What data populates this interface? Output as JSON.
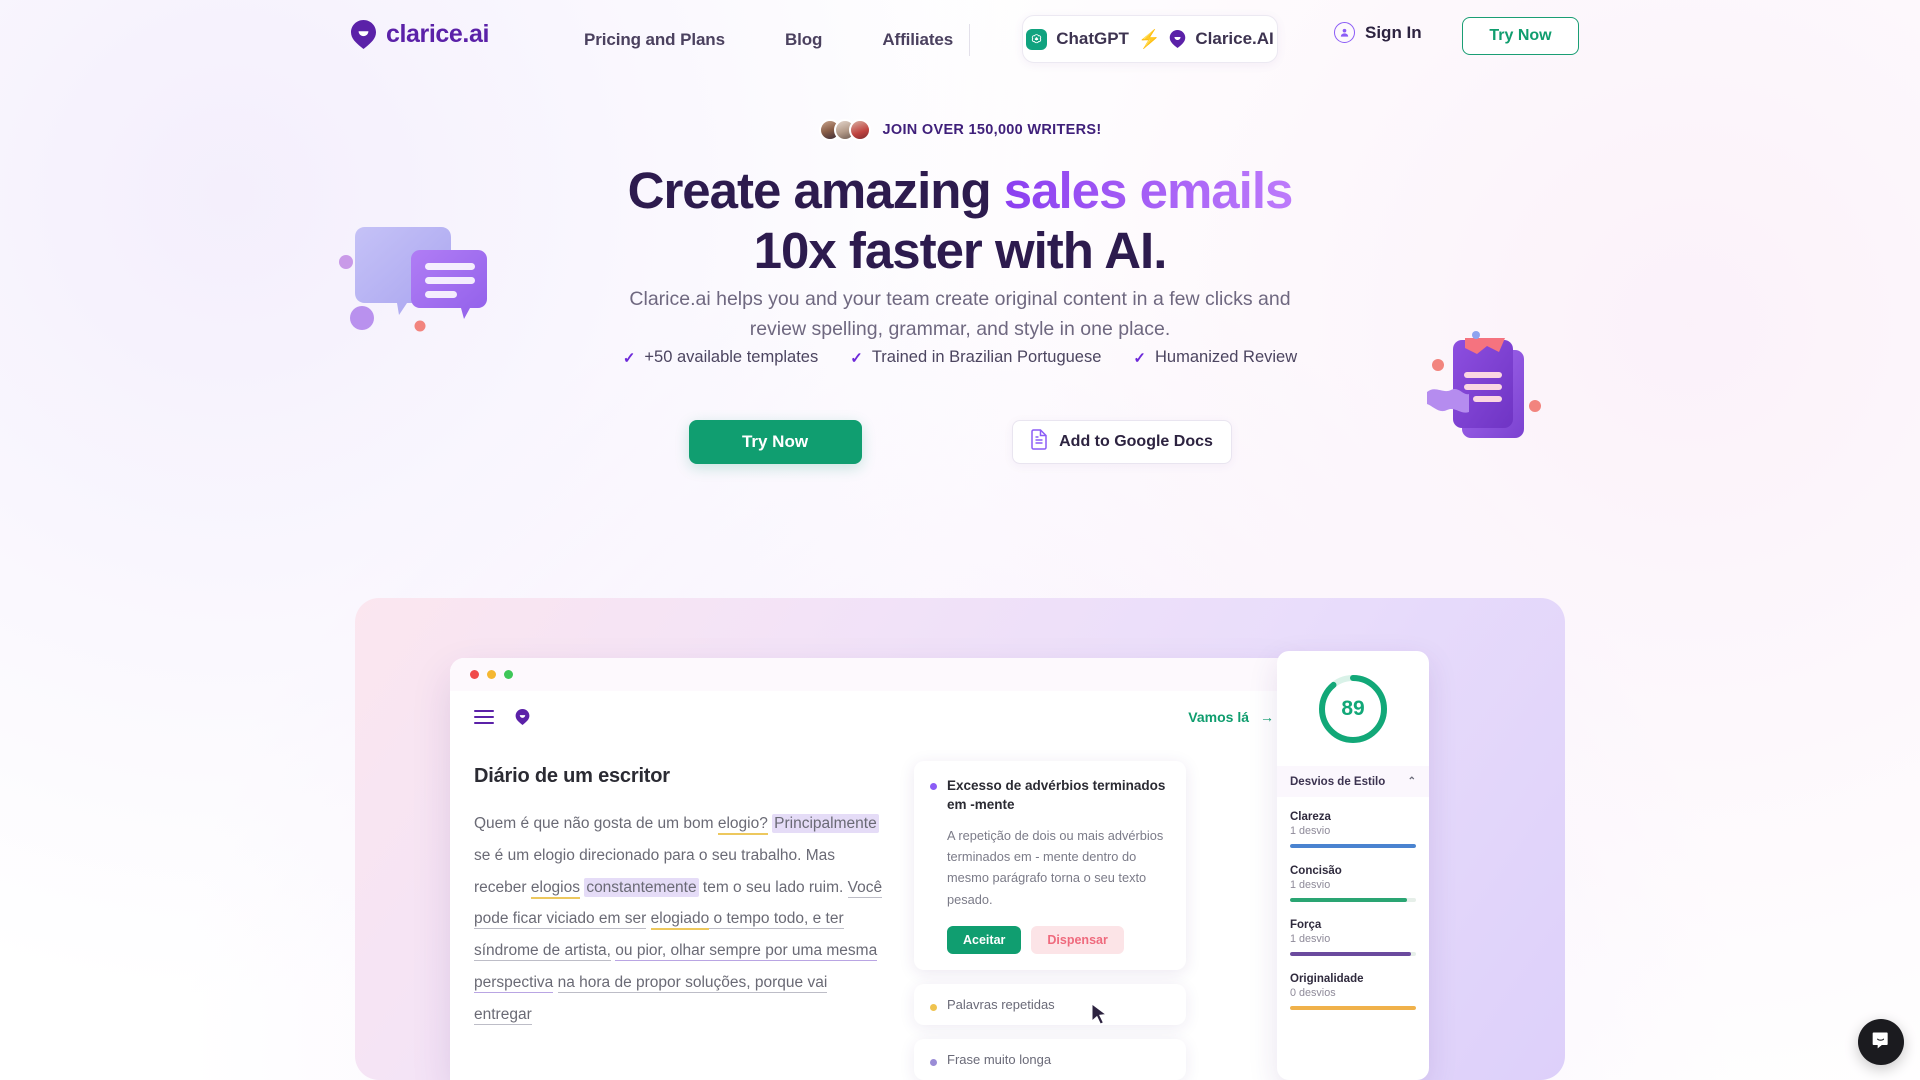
{
  "nav": {
    "logo_text": "clarice.ai",
    "links": [
      {
        "label": "Pricing and Plans"
      },
      {
        "label": "Blog"
      },
      {
        "label": "Affiliates"
      }
    ],
    "integration_pill": {
      "chatgpt_label": "ChatGPT",
      "clarice_label": "Clarice.AI",
      "bolt_glyph": "⚡"
    },
    "sign_in_label": "Sign In",
    "try_now_label": "Try Now"
  },
  "hero": {
    "join_text": "JOIN OVER 150,000 WRITERS!",
    "headline_line1_plain": "Create amazing ",
    "headline_line1_accent": "sales emails",
    "headline_line2": "10x faster with AI.",
    "subhead_line1": "Clarice.ai helps you and your team create original content in a few clicks and",
    "subhead_line2": "review spelling, grammar, and style in one place.",
    "features": [
      {
        "label": "+50 available templates"
      },
      {
        "label": "Trained in Brazilian Portuguese"
      },
      {
        "label": "Humanized Review"
      }
    ],
    "cta_primary": "Try Now",
    "cta_secondary": "Add to Google Docs"
  },
  "app": {
    "go_label": "Vamos lá",
    "arrow_glyph": "→",
    "doc": {
      "title": "Diário de um escritor",
      "p_seg1": "Quem é que não gosta de um bom ",
      "p_seg2_underline_yellow": "elogio?",
      "p_seg3_highlight": "Principalmente",
      "p_seg4": " se é um elogio direcionado para o seu trabalho. Mas receber ",
      "p_seg5_underline_yellow": "elogios",
      "p_seg6_highlight": "constantemente",
      "p_seg7": " tem o seu lado ruim. ",
      "p_seg8_underline_gray": "Você pode ficar viciado em ser",
      "p_seg9_underline_yellow": "elogiado",
      "p_seg10_underline_gray": " o tempo todo, e ter síndrome de artista,",
      "p_seg11_underline_purple": "ou pior, olhar sempre por uma mesma perspectiva",
      "p_seg12_underline_gray": "na hora de propor soluções, porque vai entregar"
    },
    "suggestion": {
      "title": "Excesso de advérbios terminados em -mente",
      "description": "A repetição de dois ou mais advérbios terminados em - mente dentro do mesmo parágrafo torna o seu texto pesado.",
      "accept_label": "Aceitar",
      "dismiss_label": "Dispensar"
    },
    "mini_cards": [
      {
        "label": "Palavras repetidas",
        "color": "#efc34f"
      },
      {
        "label": "Frase muito longa",
        "color": "#9a8cd6"
      }
    ],
    "score": {
      "value": "89",
      "percent": 89,
      "panel_title": "Desvios de Estilo",
      "caret_glyph": "⌃"
    },
    "metrics": [
      {
        "name": "Clareza",
        "sub": "1 desvio",
        "percent": 100,
        "color": "#4a83d0"
      },
      {
        "name": "Concisão",
        "sub": "1 desvio",
        "percent": 93,
        "color": "#2aa573"
      },
      {
        "name": "Força",
        "sub": "1 desvio",
        "percent": 96,
        "color": "#6b4a9e"
      },
      {
        "name": "Originalidade",
        "sub": "0 desvios",
        "percent": 100,
        "color": "#f0b14a"
      }
    ]
  },
  "colors": {
    "brand_purple": "#5b21a8",
    "accent_green": "#109e70",
    "accent_violet": "#8b5cf6",
    "headline_dark": "#2d1b4e"
  }
}
